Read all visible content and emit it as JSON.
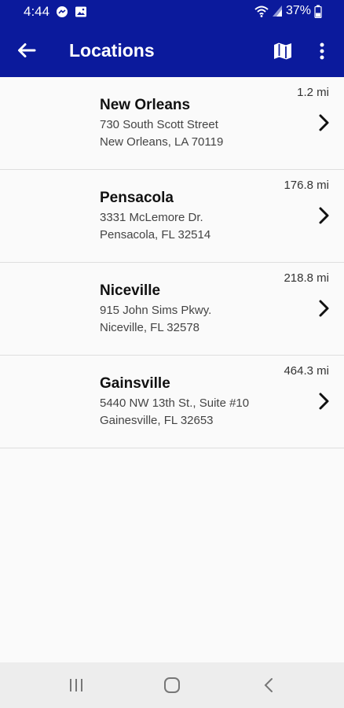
{
  "status_bar": {
    "time": "4:44",
    "battery": "37%",
    "icons": [
      "messenger-icon",
      "image-icon",
      "wifi-icon",
      "signal-icon",
      "battery-icon"
    ]
  },
  "app_bar": {
    "title": "Locations",
    "icons": [
      "back-arrow-icon",
      "map-icon",
      "more-vertical-icon"
    ]
  },
  "locations": [
    {
      "name": "New Orleans",
      "address_line1": "730 South Scott Street",
      "address_line2": "New Orleans, LA 70119",
      "distance": "1.2 mi"
    },
    {
      "name": "Pensacola",
      "address_line1": "3331 McLemore Dr.",
      "address_line2": "Pensacola, FL 32514",
      "distance": "176.8 mi"
    },
    {
      "name": "Niceville",
      "address_line1": "915 John Sims Pkwy.",
      "address_line2": "Niceville, FL 32578",
      "distance": "218.8 mi"
    },
    {
      "name": "Gainsville",
      "address_line1": "5440 NW 13th St., Suite #10",
      "address_line2": "Gainesville, FL 32653",
      "distance": "464.3 mi"
    }
  ],
  "nav_bar": {
    "icons": [
      "recent-apps-icon",
      "home-icon",
      "back-icon"
    ]
  },
  "colors": {
    "primary": "#0b1a9c",
    "background": "#fafafa",
    "divider": "#dedede",
    "nav_bar": "#ededed"
  }
}
